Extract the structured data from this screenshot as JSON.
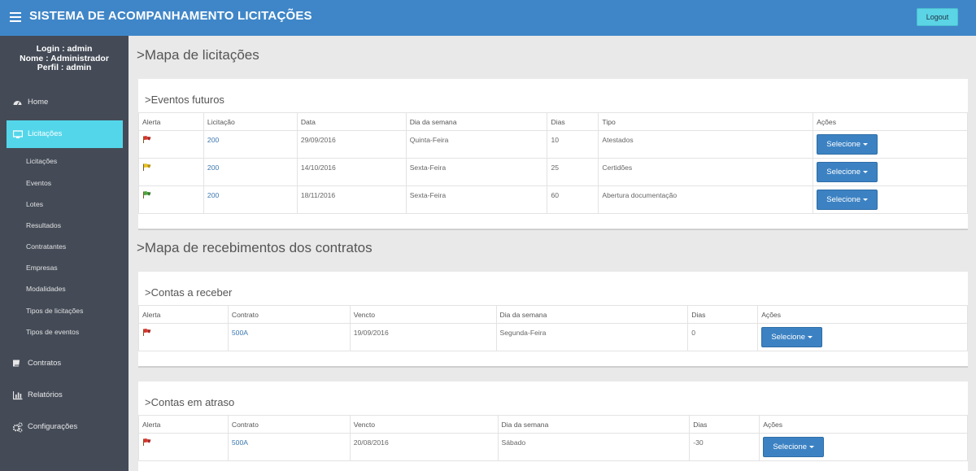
{
  "header": {
    "title": "SISTEMA DE ACOMPANHAMENTO LICITAÇÕES",
    "logout_label": "Logout"
  },
  "user": {
    "login": "Login : admin",
    "nome": "Nome : Administrador",
    "perfil": "Perfil : admin"
  },
  "sidebar": {
    "home": "Home",
    "licitacoes": "Licitações",
    "sub": [
      "Licitações",
      "Eventos",
      "Lotes",
      "Resultados",
      "Contratantes",
      "Empresas",
      "Modalidades",
      "Tipos de licitações",
      "Tipos de eventos"
    ],
    "contratos": "Contratos",
    "relatorios": "Relatórios",
    "configuracoes": "Configurações"
  },
  "mapa_licitacoes": {
    "heading": ">Mapa de licitações",
    "panel_title": ">Eventos futuros",
    "columns": [
      "Alerta",
      "Licitação",
      "Data",
      "Dia da semana",
      "Dias",
      "Tipo",
      "Ações"
    ],
    "rows": [
      {
        "alert": "red",
        "licitacao": "200",
        "data": "29/09/2016",
        "dia": "Quinta-Feira",
        "dias": "10",
        "tipo": "Atestados",
        "acao": "Selecione"
      },
      {
        "alert": "yellow",
        "licitacao": "200",
        "data": "14/10/2016",
        "dia": "Sexta-Feira",
        "dias": "25",
        "tipo": "Certidões",
        "acao": "Selecione"
      },
      {
        "alert": "green",
        "licitacao": "200",
        "data": "18/11/2016",
        "dia": "Sexta-Feira",
        "dias": "60",
        "tipo": "Abertura documentação",
        "acao": "Selecione"
      }
    ]
  },
  "mapa_recebimentos": {
    "heading": ">Mapa de recebimentos dos contratos",
    "contas_receber": {
      "title": ">Contas a receber",
      "columns": [
        "Alerta",
        "Contrato",
        "Vencto",
        "Dia da semana",
        "Dias",
        "Ações"
      ],
      "rows": [
        {
          "alert": "red",
          "contrato": "500A",
          "vencto": "19/09/2016",
          "dia": "Segunda-Feira",
          "dias": "0",
          "acao": "Selecione"
        }
      ]
    },
    "contas_atraso": {
      "title": ">Contas em atraso",
      "columns": [
        "Alerta",
        "Contrato",
        "Vencto",
        "Dia da semana",
        "Dias",
        "Ações"
      ],
      "rows": [
        {
          "alert": "red",
          "contrato": "500A",
          "vencto": "20/08/2016",
          "dia": "Sábado",
          "dias": "-30",
          "acao": "Selecione"
        }
      ]
    }
  },
  "colors": {
    "header": "#3f86c8",
    "sidebar": "#444b57",
    "active": "#54d6ea",
    "button": "#3c82c3",
    "alert_red": "#d9342b",
    "alert_yellow": "#e8c21e",
    "alert_green": "#4da63a"
  }
}
